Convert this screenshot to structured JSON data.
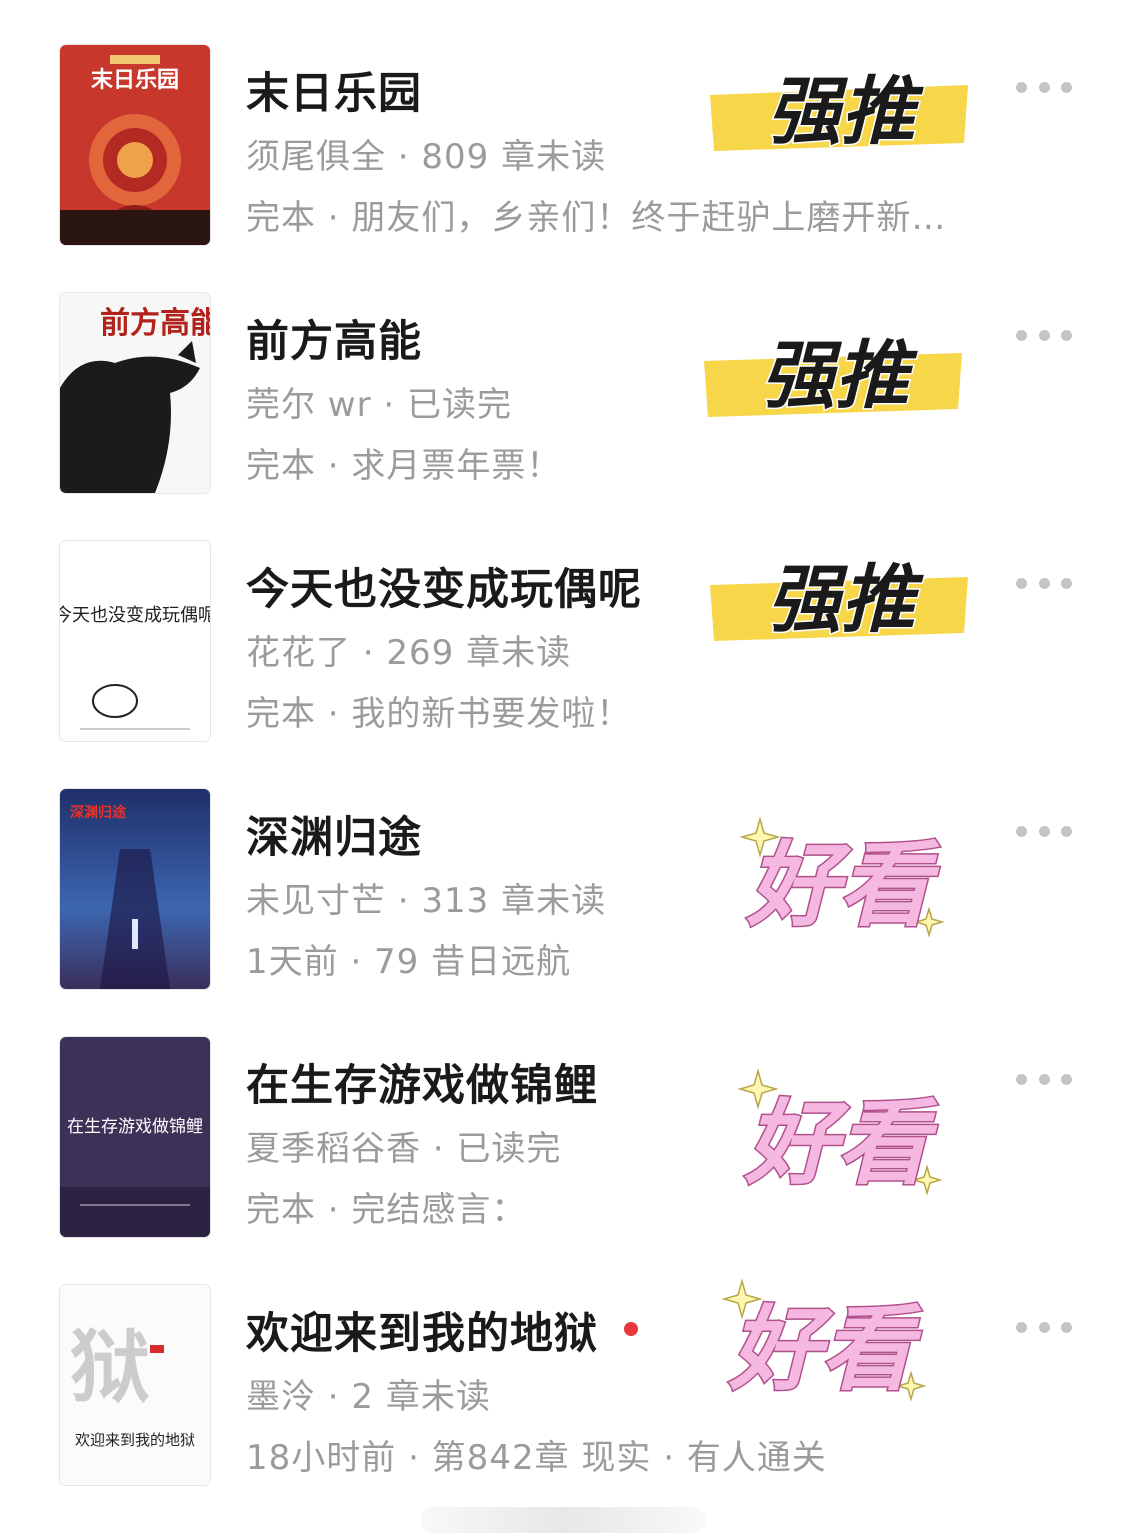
{
  "books": [
    {
      "title": "末日乐园",
      "meta": "须尾俱全 · 809 章未读",
      "sub": "完本 · 朋友们，乡亲们！终于赶驴上磨开新…",
      "tag": "强推",
      "cover_text": "末日乐园",
      "has_new": false
    },
    {
      "title": "前方高能",
      "meta": "莞尔 wr · 已读完",
      "sub": "完本 · 求月票年票！",
      "tag": "强推",
      "cover_text": "前方高能",
      "has_new": false
    },
    {
      "title": "今天也没变成玩偶呢",
      "meta": "花花了 · 269 章未读",
      "sub": "完本 · 我的新书要发啦！",
      "tag": "强推",
      "cover_text": "今天也没变成玩偶呢",
      "has_new": false
    },
    {
      "title": "深渊归途",
      "meta": "未见寸芒 · 313 章未读",
      "sub": "1天前 · 79 昔日远航",
      "tag": "好看",
      "cover_text": "深渊归途",
      "has_new": false
    },
    {
      "title": "在生存游戏做锦鲤",
      "meta": "夏季稻谷香 · 已读完",
      "sub": "完本 · 完结感言：",
      "tag": "好看",
      "cover_text": "在生存游戏做锦鲤",
      "has_new": false
    },
    {
      "title": "欢迎来到我的地狱",
      "meta": "墨泠 · 2 章未读",
      "sub": "18小时前 · 第842章 现实 · 有人通关",
      "tag": "好看",
      "cover_text": "欢迎来到我的地狱",
      "has_new": true
    }
  ],
  "icons": {
    "more": "more-dots-icon",
    "new_update": "red-dot-icon",
    "sparkle": "sparkle-icon"
  },
  "colors": {
    "title": "#1a1a1a",
    "meta": "#9b9b9b",
    "strong_tag_bg": "#f7d64a",
    "good_tag_fill": "#f5b8e0",
    "new_dot": "#e8383d"
  }
}
